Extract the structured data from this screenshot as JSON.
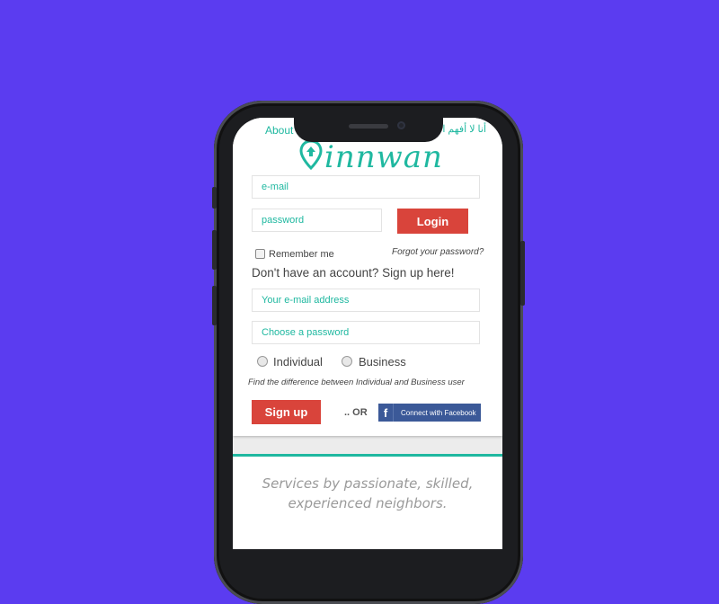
{
  "nav": {
    "about": "About",
    "arabic": "أنا لا أفهم اللغة"
  },
  "logo": {
    "text": "innwan"
  },
  "login": {
    "email_placeholder": "e-mail",
    "password_placeholder": "password",
    "login_label": "Login",
    "remember_me": "Remember me",
    "forgot": "Forgot your password?"
  },
  "signup": {
    "heading": "Don't have an account? Sign up here!",
    "email_placeholder": "Your e-mail address",
    "password_placeholder": "Choose a password",
    "radio_individual": "Individual",
    "radio_business": "Business",
    "difference_link": "Find the difference between Individual and Business user",
    "signup_label": "Sign up",
    "or_text": ".. OR",
    "facebook_label": "Connect with Facebook",
    "facebook_glyph": "f"
  },
  "tagline": {
    "line1": "Services by passionate, skilled,",
    "line2": "experienced neighbors."
  },
  "colors": {
    "background": "#5b3cf0",
    "accent": "#1fb8a0",
    "button_red": "#d9443b",
    "facebook_blue": "#3b5998"
  }
}
